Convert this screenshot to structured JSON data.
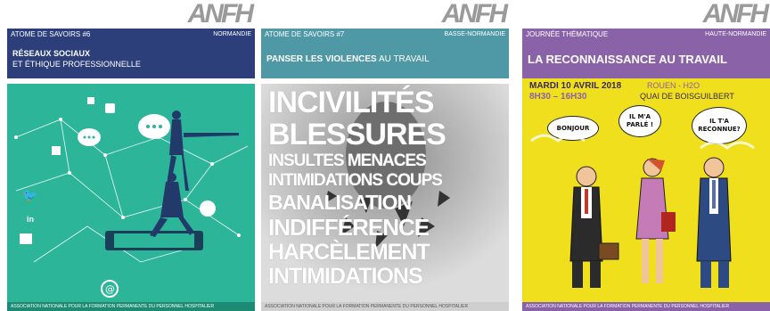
{
  "posters": [
    {
      "logo": "ANFH",
      "series": "ATOME DE SAVOIRS #6",
      "region": "NORMANDIE",
      "title_line1": "RÉSEAUX SOCIAUX",
      "title_line2": "ET ÉTHIQUE PROFESSIONNELLE",
      "footer": "ASSOCIATION NATIONALE POUR LA FORMATION PERMANENTE DU PERSONNEL HOSPITALIER"
    },
    {
      "logo": "ANFH",
      "series": "ATOME DE SAVOIRS #7",
      "region": "BASSE-NORMANDIE",
      "title_bold": "PANSER LES VIOLENCES",
      "title_light": " AU TRAVAIL",
      "words": [
        "INCIVILITÉS",
        "BLESSURES",
        "INSULTES MENACES",
        "INTIMIDATIONS COUPS",
        "BANALISATION",
        "INDIFFÉRENCE",
        "HARCÈLEMENT",
        "INTIMIDATIONS"
      ],
      "footer": "ASSOCIATION NATIONALE POUR LA FORMATION PERMANENTE DU PERSONNEL HOSPITALIER"
    },
    {
      "logo": "ANFH",
      "series": "JOURNÉE THÉMATIQUE",
      "region": "HAUTE-NORMANDIE",
      "title": "LA RECONNAISSANCE AU TRAVAIL",
      "date": "MARDI 10 AVRIL 2018",
      "time": "8H30 – 16H30",
      "place1": "ROUEN - H2O",
      "place2": "QUAI DE BOISGUILBERT",
      "bubbles": [
        "BONJOUR",
        "IL M'A PARLÉ !",
        "IL T'A RECONNUE?"
      ],
      "footer": "ASSOCIATION NATIONALE POUR LA FORMATION PERMANENTE DU PERSONNEL HOSPITALIER"
    }
  ],
  "colors": {
    "navy": "#2d3f7a",
    "teal": "#2db59a",
    "steel": "#4f98a6",
    "purple": "#8a62a8",
    "yellow": "#f0df1c"
  }
}
